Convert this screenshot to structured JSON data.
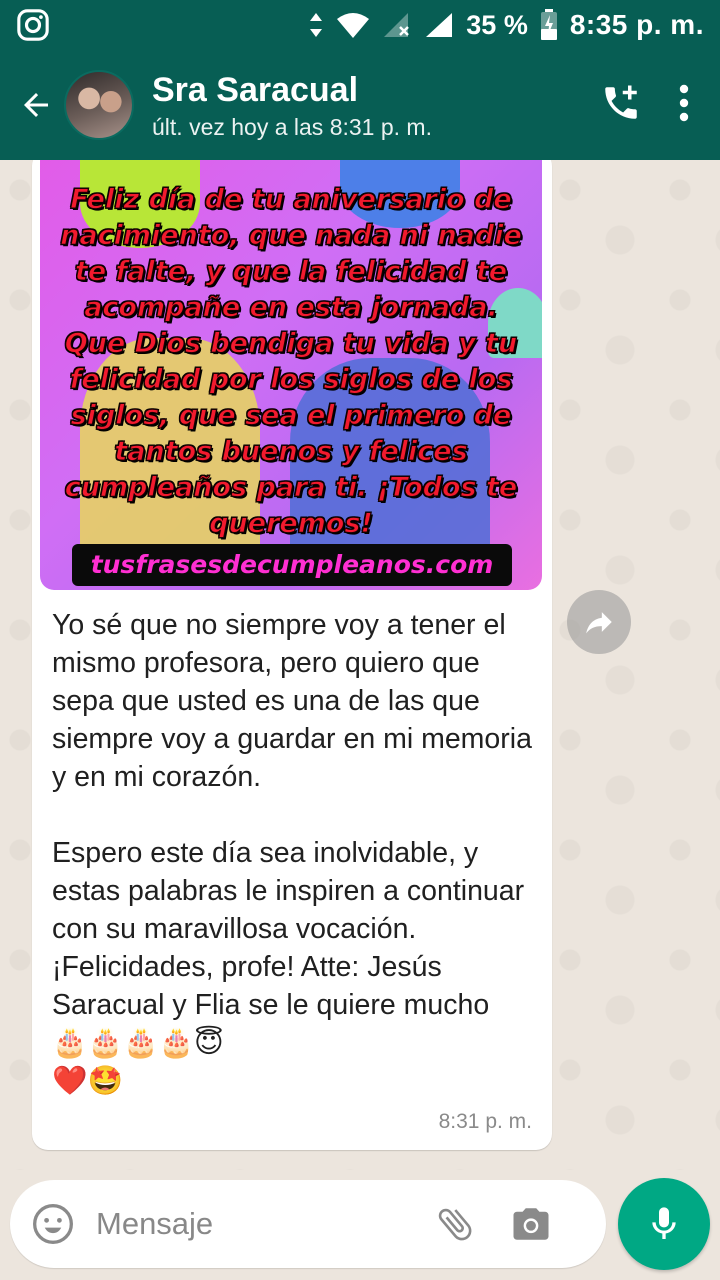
{
  "status_bar": {
    "battery": "35 %",
    "time": "8:35 p. m.",
    "icons": [
      "instagram-icon",
      "data-arrows-icon",
      "wifi-icon",
      "no-signal-icon",
      "signal-icon",
      "battery-icon"
    ]
  },
  "header": {
    "contact_name": "Sra Saracual",
    "last_seen": "últ. vez hoy a las 8:31 p. m."
  },
  "message": {
    "image_text": "Feliz día de tu aniversario de nacimiento, que nada ni nadie te falte, y que la felicidad te acompañe en esta jornada. Que Dios bendiga tu vida y tu felicidad por los siglos de los siglos, que sea el primero de tantos buenos y felices cumpleaños para ti. ¡Todos te queremos!",
    "image_site": "tusfrasesdecumpleanos.com",
    "text_part1": "Yo sé que no siempre voy a tener el mismo profesora, pero quiero que sepa que usted es una de las que siempre voy a guardar en mi memoria y en mi corazón.\n\nEspero este día sea inolvidable, y estas palabras le inspiren a continuar con su maravillosa vocación. ¡Felicidades, profe! Atte: Jesús Saracual y Flia se le quiere mucho ",
    "emojis": "🎂🎂🎂🎂😇\n❤️🤩",
    "time": "8:31 p. m."
  },
  "input": {
    "placeholder": "Mensaje"
  },
  "colors": {
    "header_bg": "#075e54",
    "chat_bg": "#ece5dd",
    "accent": "#00a884"
  }
}
